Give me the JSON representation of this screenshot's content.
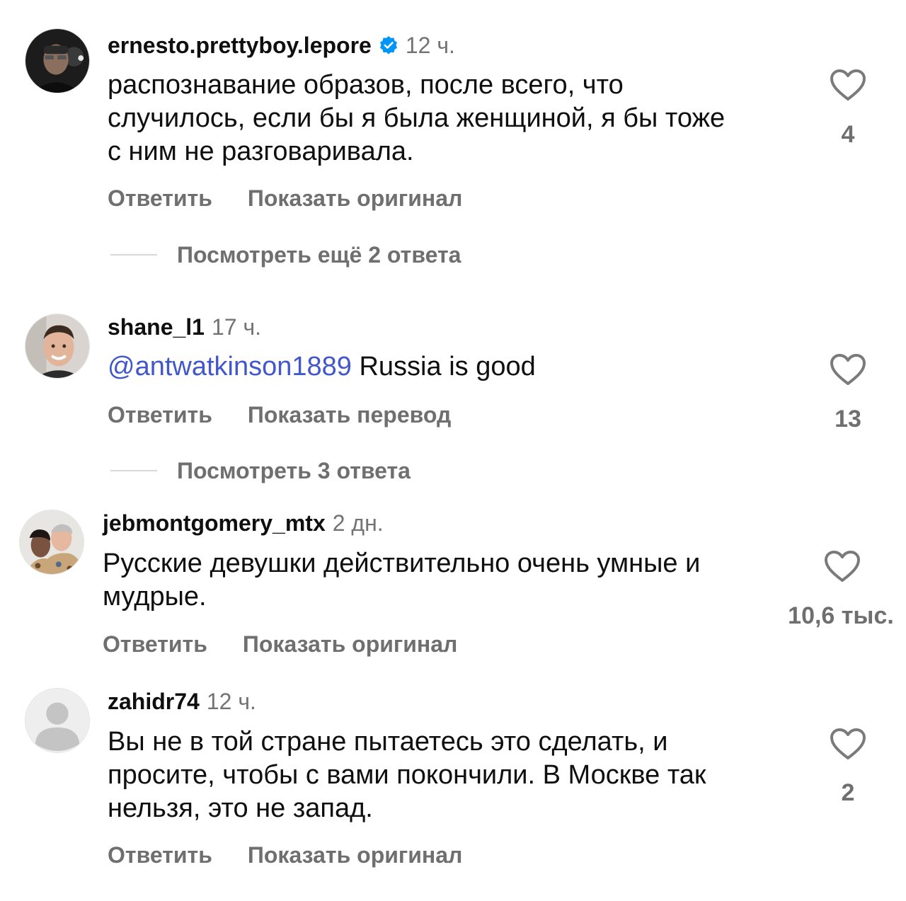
{
  "comments": [
    {
      "username": "ernesto.prettyboy.lepore",
      "verified": true,
      "time": "12 ч.",
      "text": "распознавание образов, после всего, что\nслучилось, если бы я была женщиной, я бы тоже\nс ним не разговаривала.",
      "likes": "4",
      "reply_label": "Ответить",
      "secondary_label": "Показать оригинал",
      "view_replies": "Посмотреть ещё 2 ответа"
    },
    {
      "username": "shane_l1",
      "verified": false,
      "time": "17 ч.",
      "mention": "@antwatkinson1889",
      "text": " Russia is good",
      "likes": "13",
      "reply_label": "Ответить",
      "secondary_label": "Показать перевод",
      "view_replies": "Посмотреть 3 ответа"
    },
    {
      "username": "jebmontgomery_mtx",
      "verified": false,
      "time": "2 дн.",
      "text": "Русские девушки действительно очень умные и\nмудрые.",
      "likes": "10,6 тыс.",
      "reply_label": "Ответить",
      "secondary_label": "Показать оригинал"
    },
    {
      "username": "zahidr74",
      "verified": false,
      "time": "12 ч.",
      "text": "Вы не в той стране пытаетесь это сделать, и\nпросите, чтобы с вами покончили. В Москве так\nнельзя, это не запад.",
      "likes": "2",
      "reply_label": "Ответить",
      "secondary_label": "Показать оригинал"
    }
  ],
  "colors": {
    "mention": "#4257c9",
    "verified_badge": "#0095f6",
    "secondary_text": "#6f6f6f",
    "time_text": "#737373"
  },
  "icons": {
    "like": "heart-outline-icon",
    "verified": "verified-badge-icon",
    "default_avatar": "person-silhouette-icon"
  }
}
